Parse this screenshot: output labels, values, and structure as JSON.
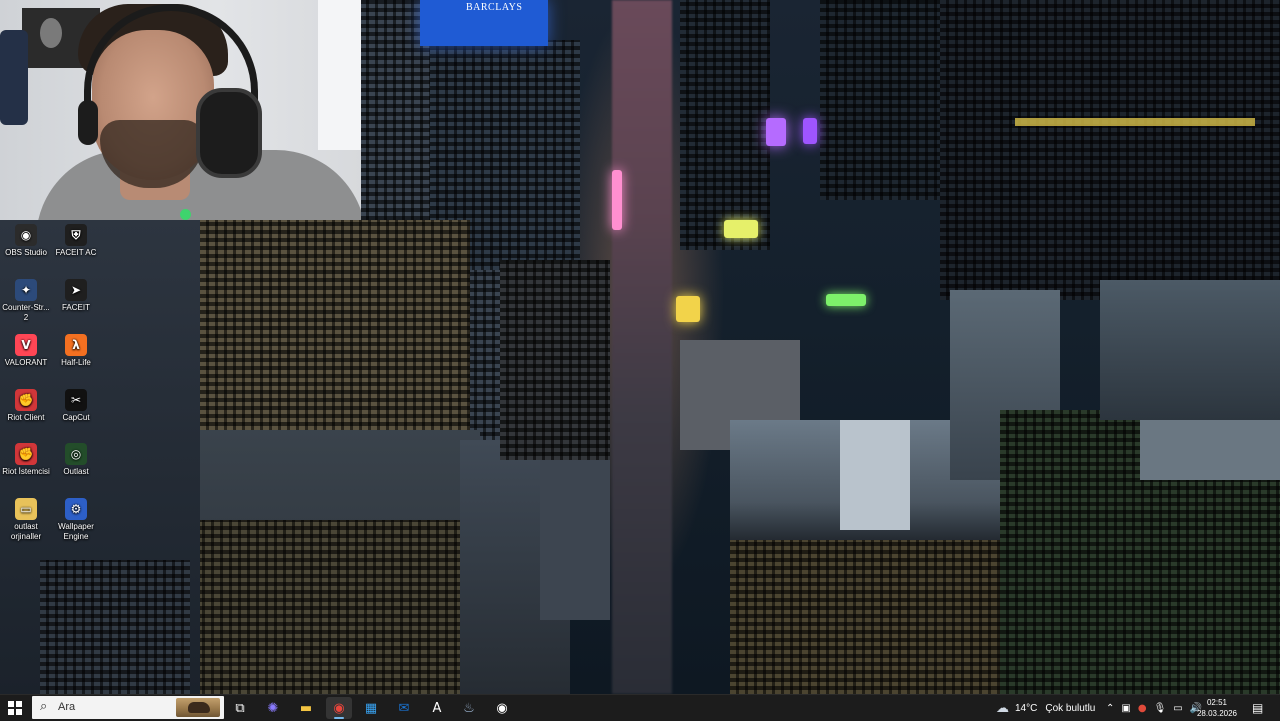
{
  "wallpaper": {
    "billboard_text": "BARCLAYS"
  },
  "desktop_icons": [
    {
      "label": "OBS Studio",
      "icon": "obs-icon",
      "color": "#2b2b2b",
      "glyph": "◉"
    },
    {
      "label": "FACEIT AC",
      "icon": "faceit-ac-icon",
      "color": "#1f1f1f",
      "glyph": "⛨"
    },
    {
      "label": "Counter-Str... 2",
      "icon": "cs2-icon",
      "color": "#2c4a7a",
      "glyph": "✦"
    },
    {
      "label": "FACEIT",
      "icon": "faceit-icon",
      "color": "#1f1f1f",
      "glyph": "➤"
    },
    {
      "label": "VALORANT",
      "icon": "valorant-icon",
      "color": "#ff4655",
      "glyph": "V"
    },
    {
      "label": "Half-Life",
      "icon": "half-life-icon",
      "color": "#f37021",
      "glyph": "λ"
    },
    {
      "label": "Riot Client",
      "icon": "riot-client-icon",
      "color": "#d13639",
      "glyph": "✊"
    },
    {
      "label": "CapCut",
      "icon": "capcut-icon",
      "color": "#111111",
      "glyph": "✂"
    },
    {
      "label": "Riot İstemcisi",
      "icon": "riot-istemcisi-icon",
      "color": "#d13639",
      "glyph": "✊"
    },
    {
      "label": "Outlast",
      "icon": "outlast-icon",
      "color": "#234d2a",
      "glyph": "◎"
    },
    {
      "label": "outlast orjinaller",
      "icon": "folder-icon",
      "color": "#e8c25a",
      "glyph": "▭"
    },
    {
      "label": "Wallpaper Engine",
      "icon": "wallpaper-engine-icon",
      "color": "#2d5fc7",
      "glyph": "⚙"
    }
  ],
  "taskbar": {
    "search_placeholder": "Ara",
    "pinned": [
      {
        "name": "task-view",
        "glyph": "⧉",
        "color": "#ffffff"
      },
      {
        "name": "copilot",
        "glyph": "✺",
        "color": "#8a7bff"
      },
      {
        "name": "file-explorer",
        "glyph": "▬",
        "color": "#f4c542"
      },
      {
        "name": "chrome",
        "glyph": "◉",
        "color": "#e8453c",
        "active": true
      },
      {
        "name": "microsoft-store",
        "glyph": "▦",
        "color": "#38a3f2"
      },
      {
        "name": "outlook",
        "glyph": "✉",
        "color": "#1a73d1"
      },
      {
        "name": "app-a",
        "glyph": "A",
        "color": "#ffffff"
      },
      {
        "name": "steam",
        "glyph": "♨",
        "color": "#9fb8d6"
      },
      {
        "name": "obs",
        "glyph": "◉",
        "color": "#ffffff"
      }
    ],
    "weather": {
      "temp": "14°C",
      "condition": "Çok bulutlu"
    },
    "clock": {
      "time": "02:51",
      "date": "28.03.2026"
    }
  }
}
